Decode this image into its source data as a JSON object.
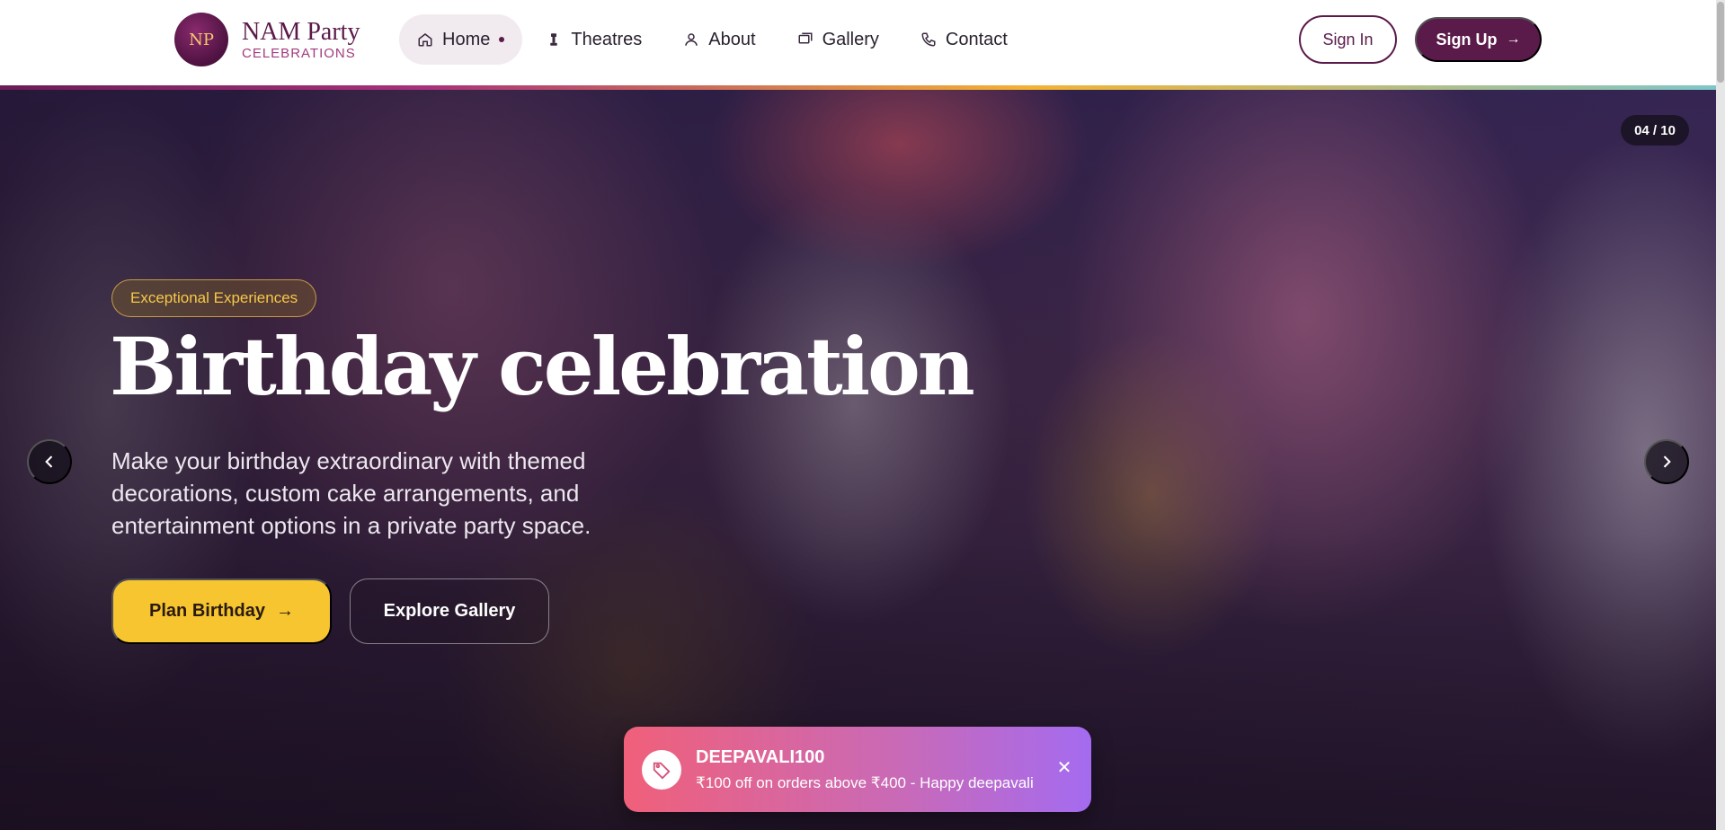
{
  "brand": {
    "name": "NAM Party",
    "subtitle": "CELEBRATIONS",
    "logo_text": "NP"
  },
  "nav": {
    "items": [
      {
        "label": "Home",
        "icon": "home-icon",
        "active": true
      },
      {
        "label": "Theatres",
        "icon": "theatre-icon",
        "active": false
      },
      {
        "label": "About",
        "icon": "user-icon",
        "active": false
      },
      {
        "label": "Gallery",
        "icon": "images-icon",
        "active": false
      },
      {
        "label": "Contact",
        "icon": "phone-icon",
        "active": false
      }
    ]
  },
  "auth": {
    "sign_in": "Sign In",
    "sign_up": "Sign Up"
  },
  "hero": {
    "counter": "04 / 10",
    "badge": "Exceptional Experiences",
    "title": "Birthday celebration",
    "description": "Make your birthday extraordinary with themed decorations, custom cake arrangements, and entertainment options in a private party space.",
    "primary_cta": "Plan Birthday",
    "secondary_cta": "Explore Gallery"
  },
  "promo": {
    "code": "DEEPAVALI100",
    "description": "₹100 off on orders above ₹400 - Happy deepavali"
  },
  "colors": {
    "brand_plum": "#5a1a4a",
    "accent_gold": "#f6c530",
    "promo_pink": "#f0607a",
    "promo_purple": "#a46bf0"
  }
}
